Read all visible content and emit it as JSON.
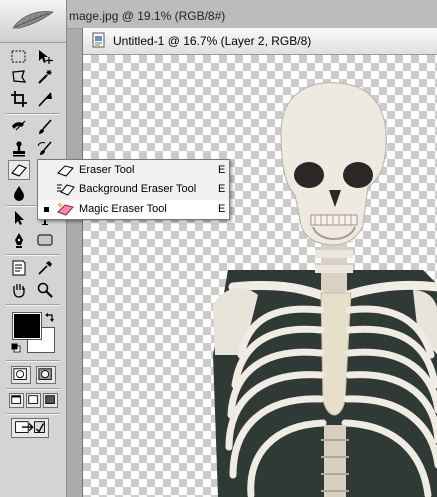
{
  "background_window": {
    "title": "mage.jpg @ 19.1% (RGB/8#)"
  },
  "document_window": {
    "title": "Untitled-1 @ 16.7% (Layer 2, RGB/8)"
  },
  "toolbox": {
    "foreground_color": "#000000",
    "background_color": "#ffffff",
    "tools": [
      {
        "name": "marquee-tool"
      },
      {
        "name": "move-tool"
      },
      {
        "name": "lasso-tool"
      },
      {
        "name": "magic-wand-tool"
      },
      {
        "name": "crop-tool"
      },
      {
        "name": "slice-tool"
      },
      {
        "name": "healing-brush-tool"
      },
      {
        "name": "brush-tool"
      },
      {
        "name": "clone-stamp-tool"
      },
      {
        "name": "history-brush-tool"
      },
      {
        "name": "eraser-tool"
      },
      {
        "name": "gradient-tool"
      },
      {
        "name": "blur-tool"
      },
      {
        "name": "dodge-tool"
      },
      {
        "name": "path-selection-tool"
      },
      {
        "name": "type-tool"
      },
      {
        "name": "pen-tool"
      },
      {
        "name": "shape-tool"
      },
      {
        "name": "notes-tool"
      },
      {
        "name": "eyedropper-tool"
      },
      {
        "name": "hand-tool"
      },
      {
        "name": "zoom-tool"
      }
    ]
  },
  "eraser_flyout": {
    "items": [
      {
        "label": "Eraser Tool",
        "shortcut": "E",
        "selected": false
      },
      {
        "label": "Background Eraser Tool",
        "shortcut": "E",
        "selected": false
      },
      {
        "label": "Magic Eraser Tool",
        "shortcut": "E",
        "selected": true
      }
    ]
  }
}
